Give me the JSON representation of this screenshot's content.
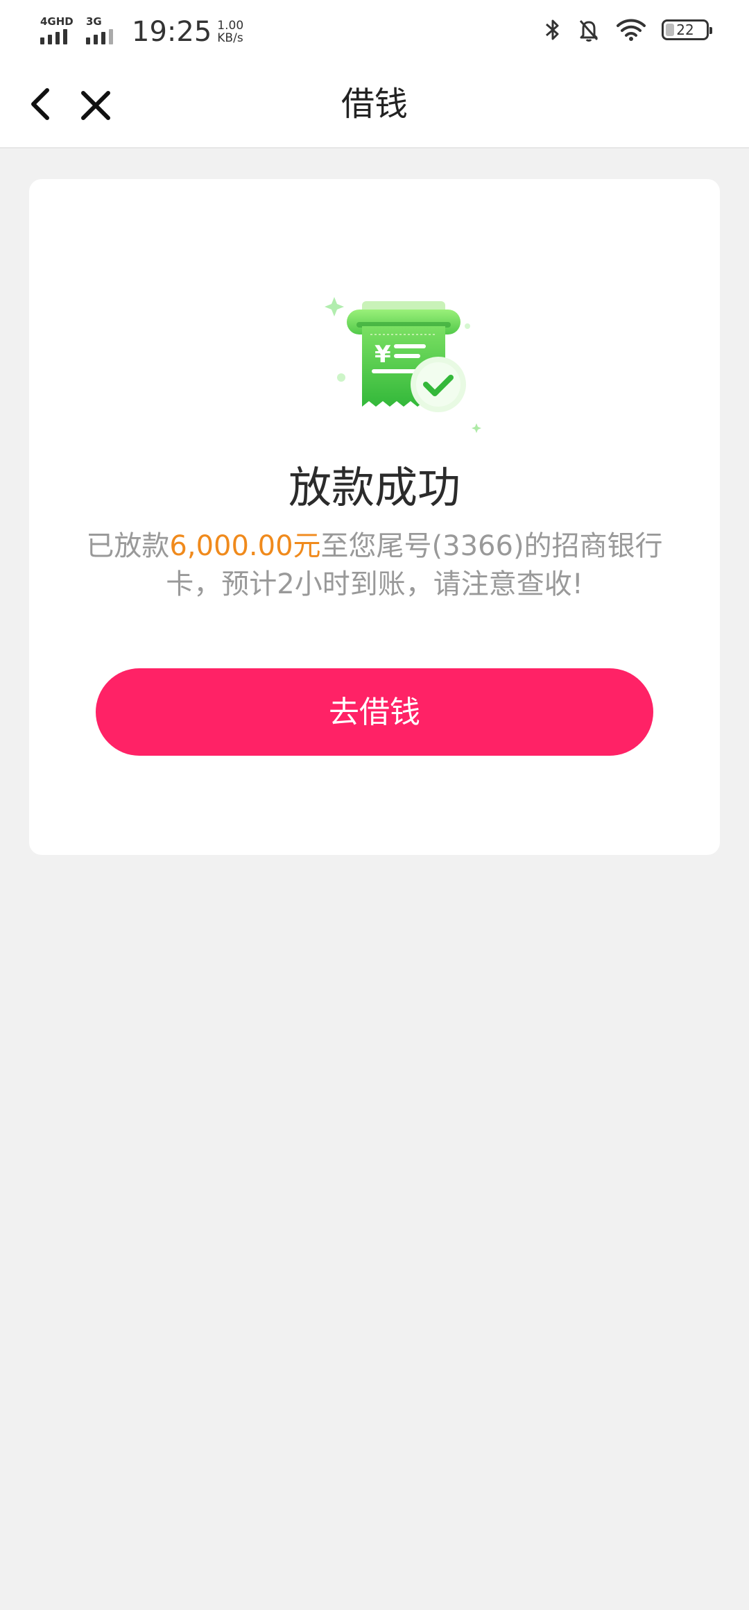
{
  "status_bar": {
    "network1": "4GHD",
    "network2": "3G",
    "time": "19:25",
    "speed_value": "1.00",
    "speed_unit": "KB/s",
    "battery": "22",
    "icons": [
      "bluetooth-icon",
      "bell-muted-icon",
      "wifi-icon",
      "battery-icon"
    ]
  },
  "nav": {
    "title": "借钱",
    "back_icon": "back-arrow-icon",
    "close_icon": "close-icon"
  },
  "result": {
    "icon": "receipt-check-icon",
    "title": "放款成功",
    "desc_prefix": "已放款",
    "amount": "6,000.00元",
    "desc_suffix": "至您尾号(3366)的招商银行卡，预计2小时到账，请注意查收!",
    "button_label": "去借钱"
  },
  "colors": {
    "accent": "#ff2266",
    "amount": "#f08a1c",
    "success_green": "#3fc43a",
    "background": "#f1f1f1"
  }
}
